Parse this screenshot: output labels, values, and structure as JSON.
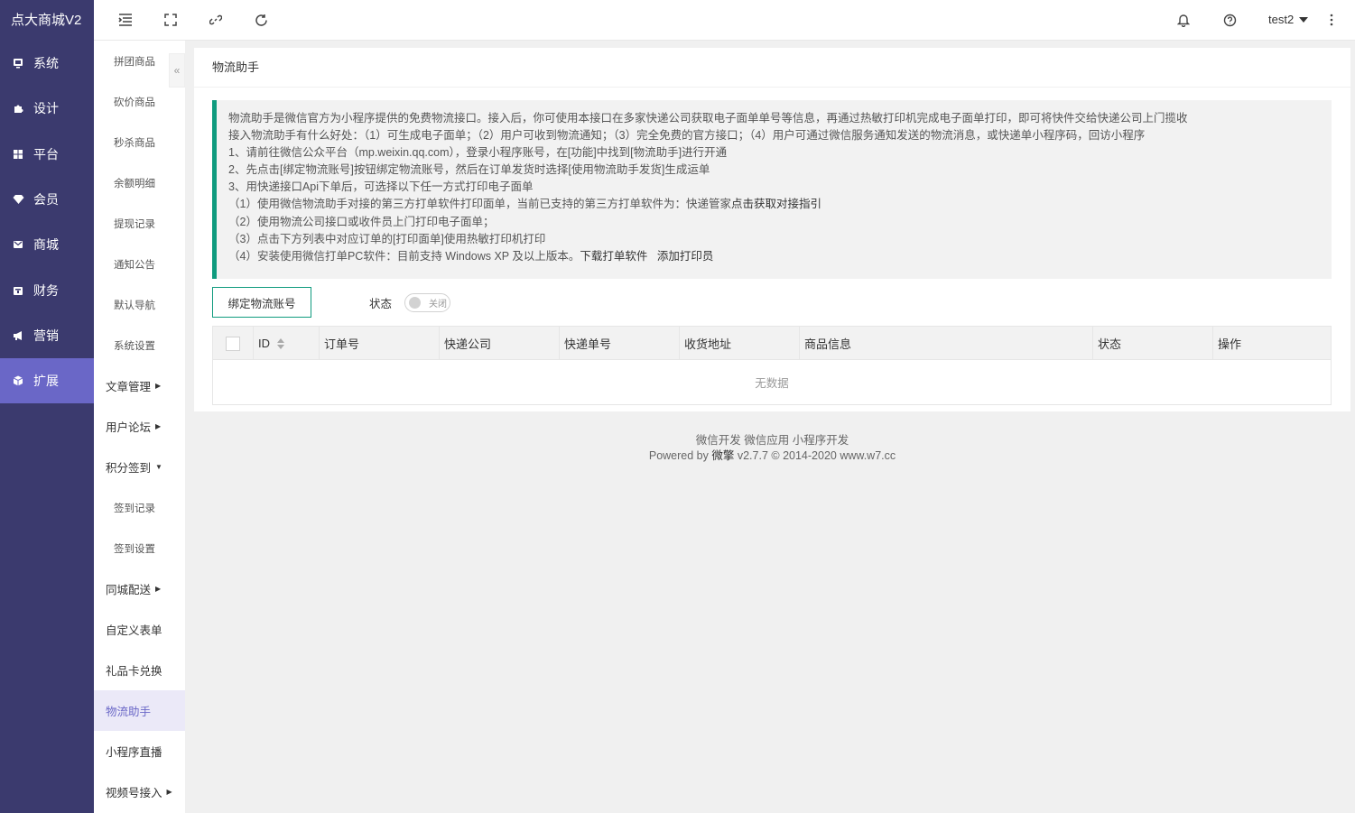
{
  "brand": "点大商城V2",
  "main_nav": [
    {
      "label": "系统",
      "icon": "monitor-icon"
    },
    {
      "label": "设计",
      "icon": "puzzle-icon"
    },
    {
      "label": "平台",
      "icon": "grid-icon"
    },
    {
      "label": "会员",
      "icon": "diamond-icon"
    },
    {
      "label": "商城",
      "icon": "mail-icon"
    },
    {
      "label": "财务",
      "icon": "wallet-icon"
    },
    {
      "label": "营销",
      "icon": "megaphone-icon"
    },
    {
      "label": "扩展",
      "icon": "cube-icon",
      "active": true
    }
  ],
  "sub_nav": {
    "pintuan": "拼团商品",
    "kanjia": "砍价商品",
    "miaosha": "秒杀商品",
    "yue": "余额明细",
    "tixian": "提现记录",
    "tongzhi": "通知公告",
    "daohang": "默认导航",
    "xitong": "系统设置",
    "wenzhang": "文章管理",
    "luntan": "用户论坛",
    "jifen": "积分签到",
    "qiandao_jilu": "签到记录",
    "qiandao_shezhi": "签到设置",
    "tongcheng": "同城配送",
    "biaodan": "自定义表单",
    "lipinka": "礼品卡兑换",
    "wuliu": "物流助手",
    "zhibo": "小程序直播",
    "shipinhao": "视频号接入"
  },
  "header": {
    "username": "test2"
  },
  "page": {
    "title": "物流助手",
    "notice": {
      "l1": "物流助手是微信官方为小程序提供的免费物流接口。接入后，你可使用本接口在多家快递公司获取电子面单单号等信息，再通过热敏打印机完成电子面单打印，即可将快件交给快递公司上门揽收",
      "l2": "接入物流助手有什么好处：（1）可生成电子面单；（2）用户可收到物流通知；（3）完全免费的官方接口；（4）用户可通过微信服务通知发送的物流消息，或快递单小程序码，回访小程序",
      "l3": "1、请前往微信公众平台（mp.weixin.qq.com），登录小程序账号，在[功能]中找到[物流助手]进行开通",
      "l4": "2、先点击[绑定物流账号]按钮绑定物流账号，然后在订单发货时选择[使用物流助手发货]生成运单",
      "l5": "3、用快递接口Api下单后，可选择以下任一方式打印电子面单",
      "l6_prefix": "（1）使用微信物流助手对接的第三方打单软件打印面单，当前已支持的第三方打单软件为：快递管家",
      "l6_link": "点击获取对接指引",
      "l7": "（2）使用物流公司接口或收件员上门打印电子面单；",
      "l8": "（3）点击下方列表中对应订单的[打印面单]使用热敏打印机打印",
      "l9_prefix": "（4）安装使用微信打单PC软件：目前支持 Windows XP 及以上版本。",
      "l9_link1": "下载打单软件",
      "l9_link2": "添加打印员"
    },
    "bind_button": "绑定物流账号",
    "status_label": "状态",
    "switch_text": "关闭",
    "switch_on": false,
    "table": {
      "columns": [
        "ID",
        "订单号",
        "快递公司",
        "快递单号",
        "收货地址",
        "商品信息",
        "状态",
        "操作"
      ],
      "empty": "无数据"
    }
  },
  "footer": {
    "links": "微信开发 微信应用 小程序开发",
    "powered_prefix": "Powered by",
    "powered_brand": "微擎",
    "powered_suffix": "v2.7.7 © 2014-2020 www.w7.cc"
  }
}
